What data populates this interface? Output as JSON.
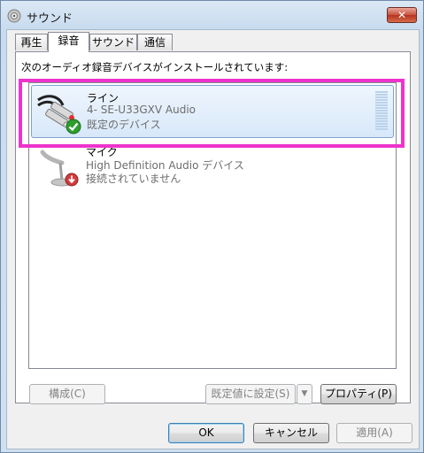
{
  "window": {
    "title": "サウンド",
    "close_symbol": "✕"
  },
  "tabs": [
    {
      "label": "再生"
    },
    {
      "label": "録音"
    },
    {
      "label": "サウンド"
    },
    {
      "label": "通信"
    }
  ],
  "active_tab": "録音",
  "panel": {
    "intro": "次のオーディオ録音デバイスがインストールされています:"
  },
  "devices": [
    {
      "name": "ライン",
      "description": "4- SE-U33GXV Audio",
      "status": "既定のデバイス",
      "icon": "line-in-cable-icon",
      "badge": "green-check-icon",
      "selected": true
    },
    {
      "name": "マイク",
      "description": "High Definition Audio デバイス",
      "status": "接続されていません",
      "icon": "microphone-icon",
      "badge": "red-down-arrow-icon",
      "selected": false
    }
  ],
  "panel_buttons": {
    "configure": "構成(C)",
    "set_default": "既定値に設定(S)",
    "properties": "プロパティ(P)"
  },
  "dialog_buttons": {
    "ok": "OK",
    "cancel": "キャンセル",
    "apply": "適用(A)"
  },
  "colors": {
    "highlight": "#ee33cc",
    "selection": "#d8e8f9"
  }
}
